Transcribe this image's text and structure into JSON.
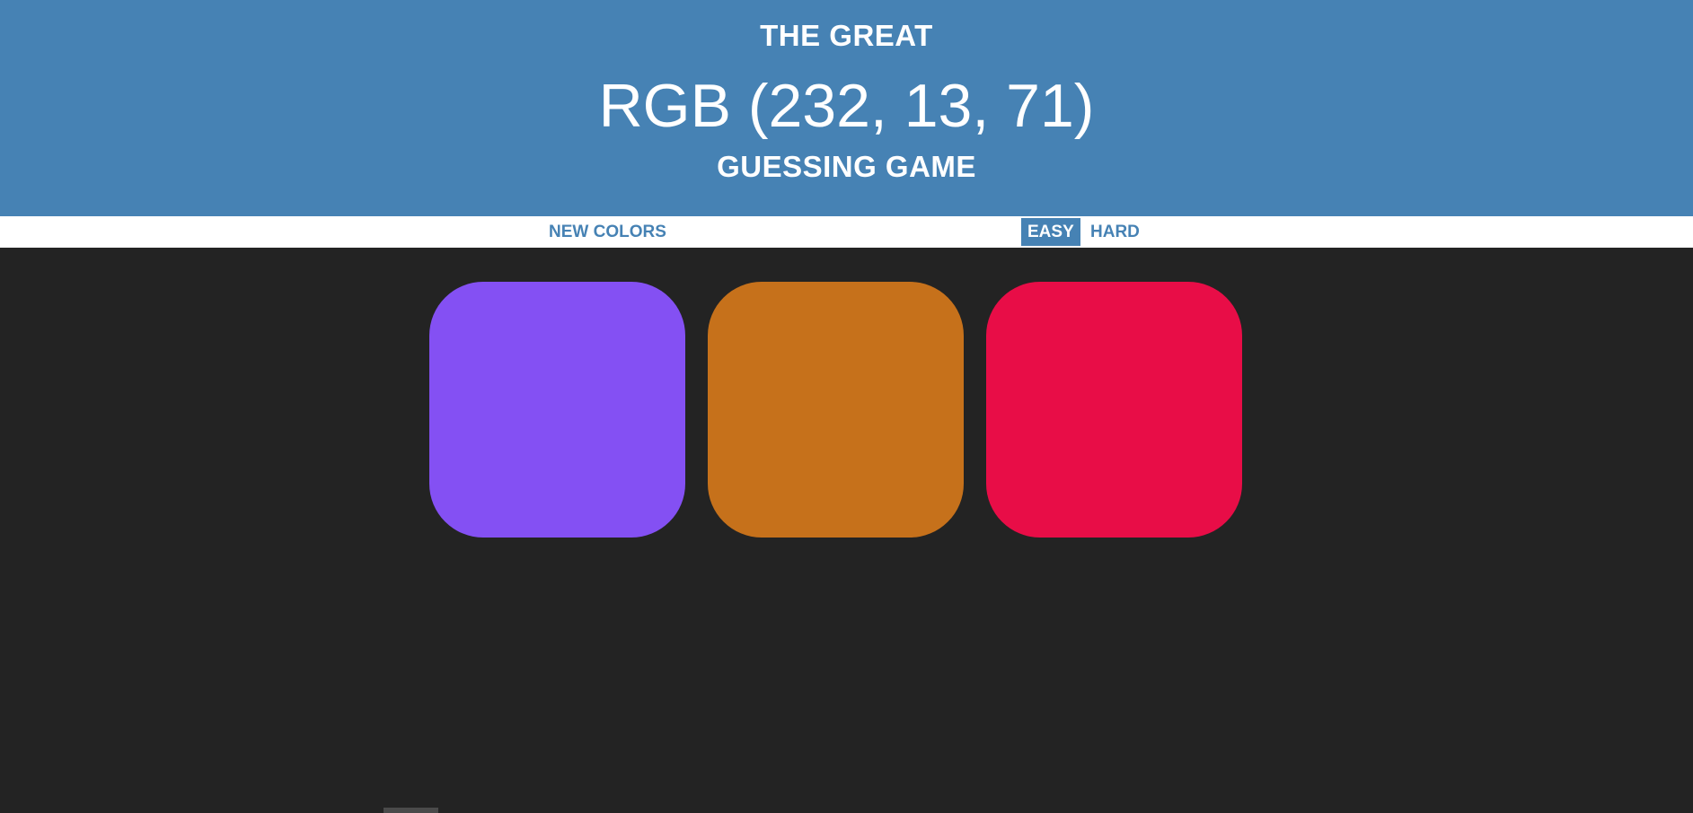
{
  "header": {
    "title_top": "THE GREAT",
    "target_rgb": "RGB (232, 13, 71)",
    "title_bottom": "GUESSING GAME",
    "background_color": "#4682b4"
  },
  "controls": {
    "new_colors_label": "NEW COLORS",
    "message": "",
    "modes": [
      {
        "label": "EASY",
        "selected": true
      },
      {
        "label": "HARD",
        "selected": false
      }
    ]
  },
  "board": {
    "background_color": "#232323",
    "squares": [
      {
        "color": "#8450f3"
      },
      {
        "color": "#c6711b"
      },
      {
        "color": "#e80d47"
      }
    ]
  }
}
